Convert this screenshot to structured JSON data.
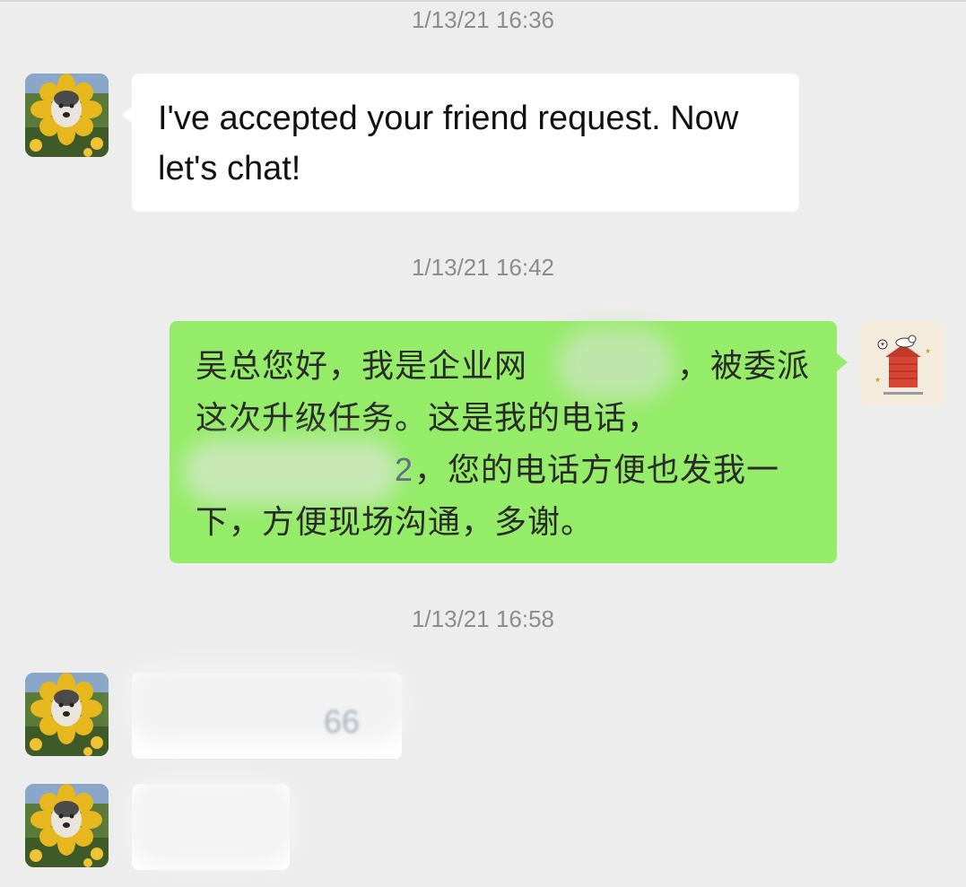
{
  "timestamps": [
    "1/13/21 16:36",
    "1/13/21 16:42",
    "1/13/21 16:58"
  ],
  "messages": {
    "m1": {
      "text": "I've accepted your friend request. Now let's chat!"
    },
    "m2": {
      "line1_a": "吴总您好，我是企业网",
      "line1_b": "，被委派",
      "line2": "这次升级任务。这是我的电话，",
      "line3_visible_digit": "2",
      "line3_b": "，您的电话方便也发我一",
      "line4": "下，方便现场沟通，多谢。"
    },
    "m3": {
      "redacted_tail": "66"
    }
  },
  "avatars": {
    "contact": "sunflower-dog-avatar-icon",
    "self": "snoopy-doghouse-avatar-icon"
  },
  "colors": {
    "background": "#ededed",
    "incoming_bubble": "#ffffff",
    "outgoing_bubble": "#95ec69",
    "timestamp_text": "#8c8c8c"
  }
}
